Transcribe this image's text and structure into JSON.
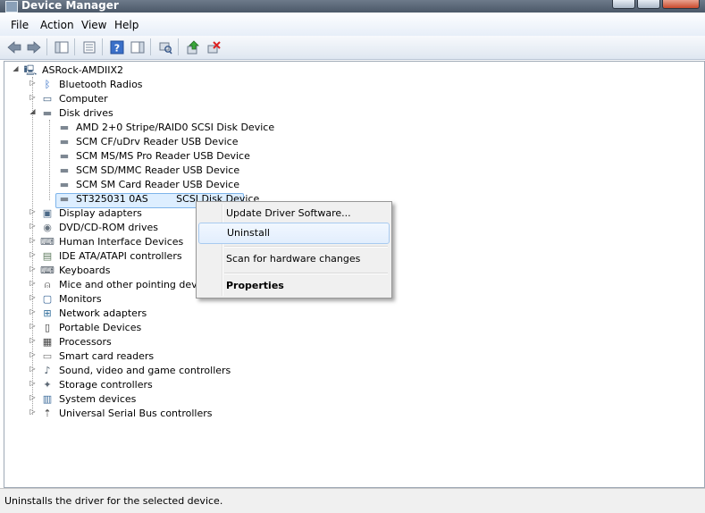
{
  "window": {
    "title": "Device Manager"
  },
  "menu": [
    "File",
    "Action",
    "View",
    "Help"
  ],
  "toolbar": {
    "buttons": [
      "back-icon",
      "forward-icon",
      "show-hide-console-tree-icon",
      "properties-icon",
      "help-icon",
      "show-action-pane-icon",
      "scan-hardware-icon",
      "update-driver-icon",
      "uninstall-icon"
    ]
  },
  "tree": {
    "root": "ASRock-AMDIIX2",
    "categories": [
      "Bluetooth Radios",
      "Computer",
      "Disk drives",
      "Display adapters",
      "DVD/CD-ROM drives",
      "Human Interface Devices",
      "IDE ATA/ATAPI controllers",
      "Keyboards",
      "Mice and other pointing devices",
      "Monitors",
      "Network adapters",
      "Portable Devices",
      "Processors",
      "Smart card readers",
      "Sound, video and game controllers",
      "Storage controllers",
      "System devices",
      "Universal Serial Bus controllers"
    ],
    "disk_drives": [
      "AMD 2+0 Stripe/RAID0 SCSI Disk Device",
      "SCM CF/uDrv Reader USB Device",
      "SCM MS/MS Pro Reader USB Device",
      "SCM SD/MMC Reader USB Device",
      "SCM SM Card Reader USB Device",
      "ST325031 0AS         SCSI Disk Device"
    ]
  },
  "context_menu": {
    "items": [
      "Update Driver Software...",
      "Uninstall",
      "Scan for hardware changes",
      "Properties"
    ]
  },
  "status": {
    "text": "Uninstalls the driver for the selected device."
  }
}
